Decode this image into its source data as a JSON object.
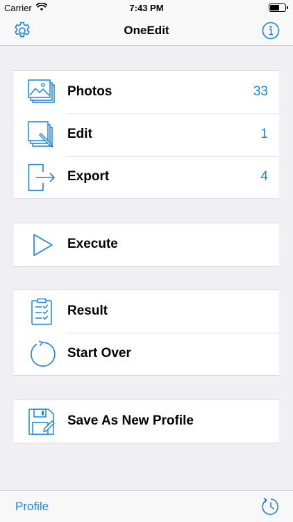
{
  "status_bar": {
    "carrier": "Carrier",
    "time": "7:43 PM"
  },
  "nav": {
    "title": "OneEdit",
    "left_icon": "gear-icon",
    "right_icon": "info-icon"
  },
  "groups": [
    {
      "rows": [
        {
          "label": "Photos",
          "count": "33",
          "icon": "photos-icon"
        },
        {
          "label": "Edit",
          "count": "1",
          "icon": "edit-icon"
        },
        {
          "label": "Export",
          "count": "4",
          "icon": "export-icon"
        }
      ]
    },
    {
      "rows": [
        {
          "label": "Execute",
          "icon": "play-icon"
        }
      ]
    },
    {
      "rows": [
        {
          "label": "Result",
          "icon": "clipboard-check-icon"
        },
        {
          "label": "Start Over",
          "icon": "refresh-icon"
        }
      ]
    },
    {
      "rows": [
        {
          "label": "Save As New Profile",
          "icon": "save-icon"
        }
      ]
    }
  ],
  "tab_bar": {
    "profile_label": "Profile",
    "right_icon": "history-icon"
  },
  "colors": {
    "accent": "#1a83d6",
    "background": "#efeff4"
  }
}
